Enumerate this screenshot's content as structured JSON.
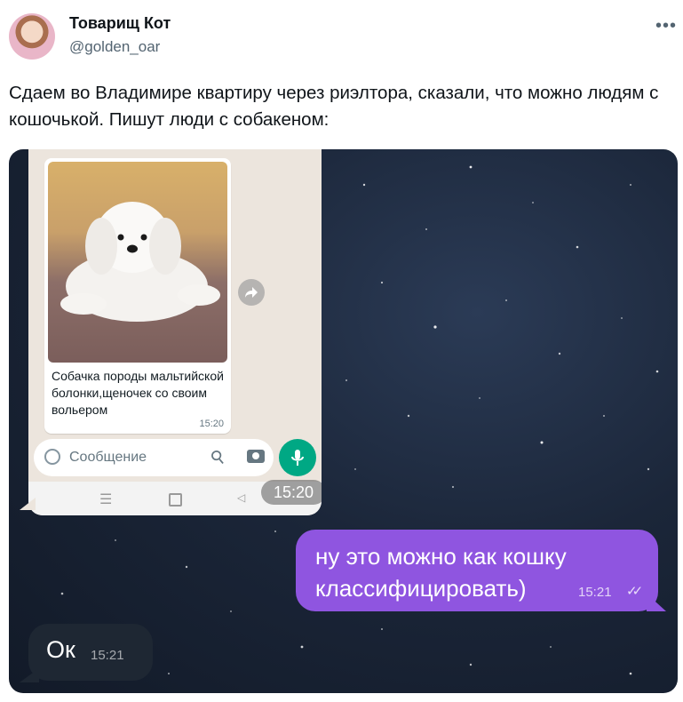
{
  "tweet": {
    "display_name": "Товарищ Кот",
    "handle": "@golden_oar",
    "more_icon": "more-horizontal-icon",
    "text": "Сдаем во Владимире квартиру через риэлтора, сказали, что можно людям с кошочькой. Пишут люди с собакеном:"
  },
  "chat": {
    "embedded_message": {
      "caption": "Собачка породы мальтийской болонки,щеночек со своим вольером",
      "time": "15:20"
    },
    "input_placeholder": "Сообщение",
    "screenshot_time": "15:20",
    "outgoing": {
      "text": "ну это можно как кошку классифицировать)",
      "time": "15:21",
      "status_icon": "double-check-icon"
    },
    "incoming": {
      "text": "Ок",
      "time": "15:21"
    }
  },
  "colors": {
    "outgoing_bubble": "#8f55e0",
    "incoming_bubble": "#1e2733",
    "whatsapp_green": "#00a884",
    "handle_gray": "#536471"
  }
}
